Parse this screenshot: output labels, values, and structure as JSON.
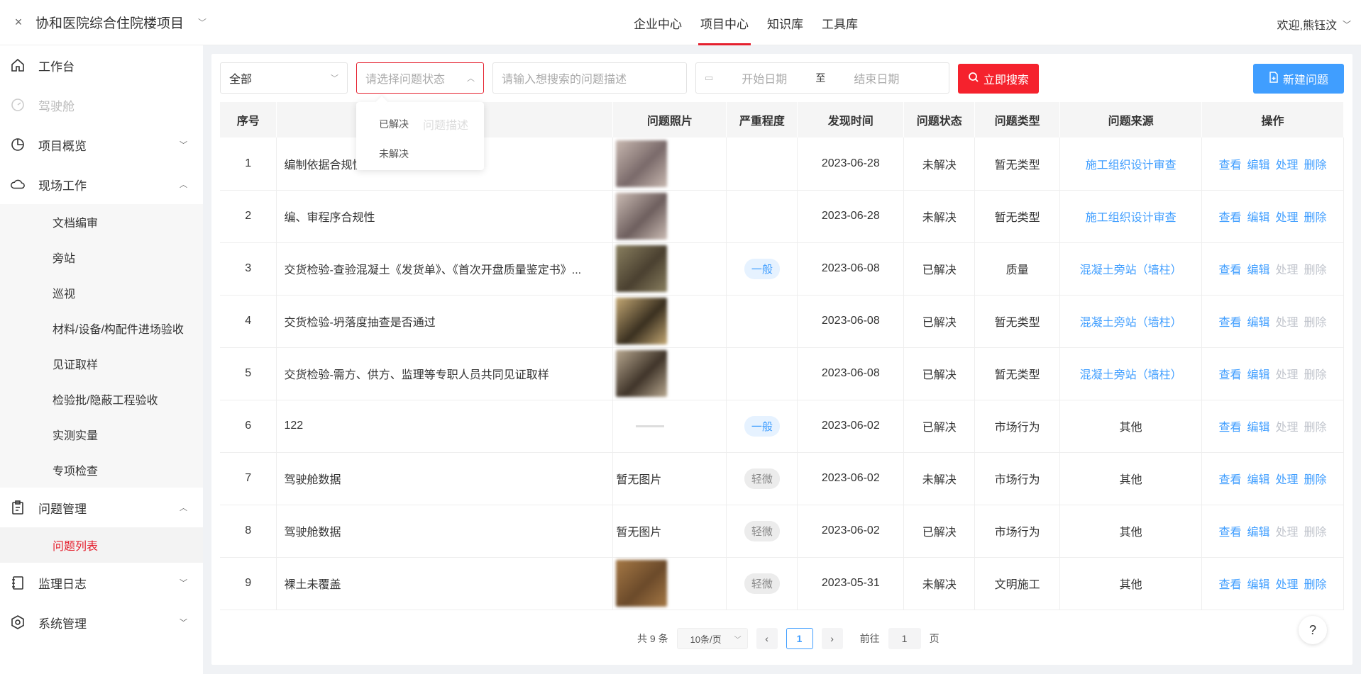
{
  "header": {
    "project_title": "协和医院综合住院楼项目",
    "nav": [
      "企业中心",
      "项目中心",
      "知识库",
      "工具库"
    ],
    "active_nav": "项目中心",
    "welcome": "欢迎,熊钰汶"
  },
  "sidebar": {
    "items": [
      {
        "label": "工作台",
        "icon": "home-icon"
      },
      {
        "label": "驾驶舱",
        "icon": "dashboard-icon"
      },
      {
        "label": "项目概览",
        "icon": "pie-chart-icon"
      },
      {
        "label": "现场工作",
        "icon": "cloud-icon"
      },
      {
        "label": "问题管理",
        "icon": "clipboard-icon"
      },
      {
        "label": "监理日志",
        "icon": "log-icon"
      },
      {
        "label": "系统管理",
        "icon": "settings-icon"
      }
    ],
    "field_work_sub": [
      "文档编审",
      "旁站",
      "巡视",
      "材料/设备/构配件进场验收",
      "见证取样",
      "检验批/隐蔽工程验收",
      "实测实量",
      "专项检查"
    ],
    "problem_sub": [
      "问题列表"
    ]
  },
  "filters": {
    "scope_value": "全部",
    "status_placeholder": "请选择问题状态",
    "desc_placeholder": "请输入想搜索的问题描述",
    "start_placeholder": "开始日期",
    "date_sep": "至",
    "end_placeholder": "结束日期",
    "search_label": "立即搜索",
    "new_label": "新建问题"
  },
  "status_dropdown": {
    "options": [
      "已解决",
      "未解决"
    ],
    "ghost": "问题描述"
  },
  "table": {
    "headers": [
      "序号",
      "问题描述",
      "问题照片",
      "严重程度",
      "发现时间",
      "问题状态",
      "问题类型",
      "问题来源",
      "操作"
    ],
    "rows": [
      {
        "no": "1",
        "desc": "编制依据合规性",
        "photo": "img",
        "severity": "",
        "date": "2023-06-28",
        "status": "未解决",
        "type": "暂无类型",
        "source": "施工组织设计审查",
        "source_link": true
      },
      {
        "no": "2",
        "desc": "编、审程序合规性",
        "photo": "img",
        "severity": "",
        "date": "2023-06-28",
        "status": "未解决",
        "type": "暂无类型",
        "source": "施工组织设计审查",
        "source_link": true
      },
      {
        "no": "3",
        "desc": "交货检验-查验混凝土《发货单》、《首次开盘质量鉴定书》...",
        "photo": "img",
        "severity": "一般",
        "date": "2023-06-08",
        "status": "已解决",
        "type": "质量",
        "source": "混凝土旁站（墙柱）",
        "source_link": true
      },
      {
        "no": "4",
        "desc": "交货检验-坍落度抽查是否通过",
        "photo": "img",
        "severity": "",
        "date": "2023-06-08",
        "status": "已解决",
        "type": "暂无类型",
        "source": "混凝土旁站（墙柱）",
        "source_link": true
      },
      {
        "no": "5",
        "desc": "交货检验-需方、供方、监理等专职人员共同见证取样",
        "photo": "img",
        "severity": "",
        "date": "2023-06-08",
        "status": "已解决",
        "type": "暂无类型",
        "source": "混凝土旁站（墙柱）",
        "source_link": true
      },
      {
        "no": "6",
        "desc": "122",
        "photo": "tiny",
        "severity": "一般",
        "date": "2023-06-02",
        "status": "已解决",
        "type": "市场行为",
        "source": "其他",
        "source_link": false
      },
      {
        "no": "7",
        "desc": "驾驶舱数据",
        "photo": "暂无图片",
        "severity": "轻微",
        "date": "2023-06-02",
        "status": "未解决",
        "type": "市场行为",
        "source": "其他",
        "source_link": false
      },
      {
        "no": "8",
        "desc": "驾驶舱数据",
        "photo": "暂无图片",
        "severity": "轻微",
        "date": "2023-06-02",
        "status": "已解决",
        "type": "市场行为",
        "source": "其他",
        "source_link": false
      },
      {
        "no": "9",
        "desc": "裸土未覆盖",
        "photo": "img",
        "severity": "轻微",
        "date": "2023-05-31",
        "status": "未解决",
        "type": "文明施工",
        "source": "其他",
        "source_link": false
      }
    ],
    "ops": [
      "查看",
      "编辑",
      "处理",
      "删除"
    ]
  },
  "pagination": {
    "total": "共 9 条",
    "page_size": "10条/页",
    "current": "1",
    "goto_prefix": "前往",
    "goto_value": "1",
    "goto_suffix": "页"
  },
  "help_label": "?",
  "colors": {
    "accent": "#e5202e",
    "primary": "#409eff"
  }
}
